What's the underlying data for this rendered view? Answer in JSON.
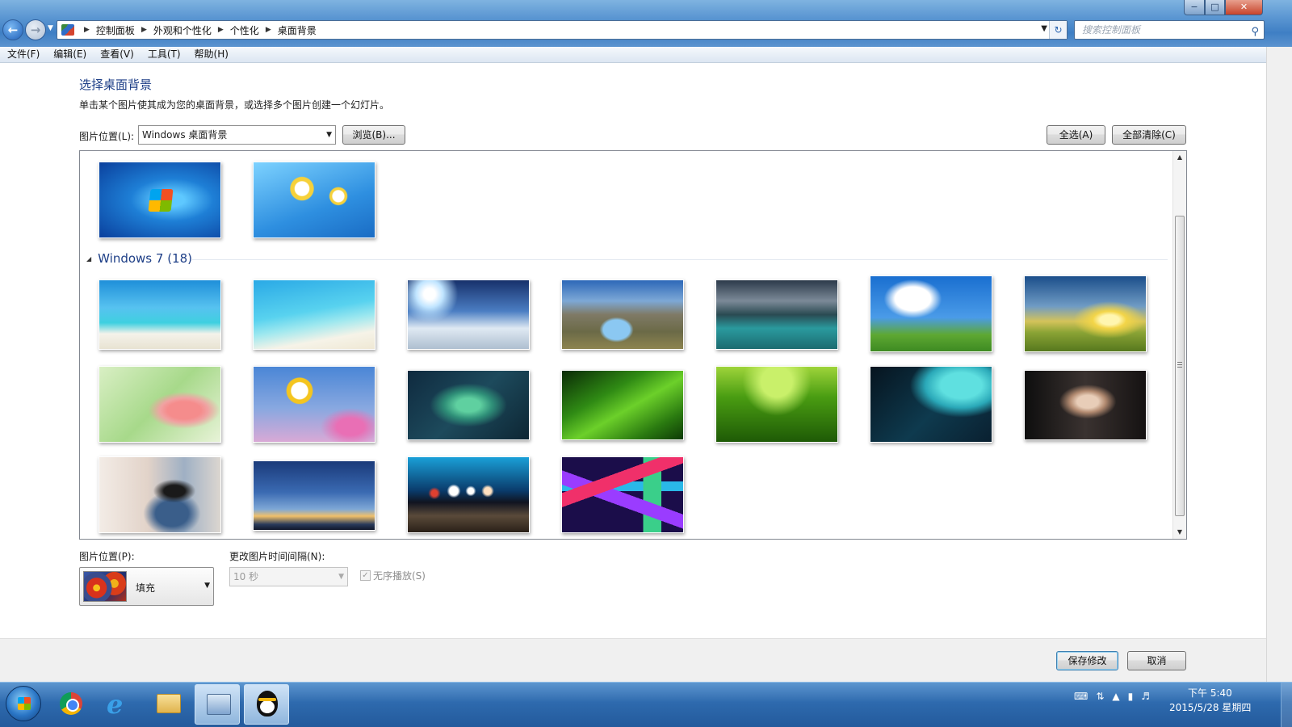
{
  "address": {
    "crumbs": [
      "控制面板",
      "外观和个性化",
      "个性化",
      "桌面背景"
    ],
    "search_placeholder": "搜索控制面板"
  },
  "window_controls": {
    "minimize": "−",
    "maximize": "□",
    "close": "✕"
  },
  "menu": [
    "文件(F)",
    "编辑(E)",
    "查看(V)",
    "工具(T)",
    "帮助(H)"
  ],
  "page": {
    "title": "选择桌面背景",
    "subtitle": "单击某个图片使其成为您的桌面背景，或选择多个图片创建一个幻灯片。",
    "location_label": "图片位置(L):",
    "location_value": "Windows 桌面背景",
    "browse_label": "浏览(B)...",
    "select_all_label": "全选(A)",
    "clear_all_label": "全部清除(C)"
  },
  "gallery": {
    "group_label": "Windows 7 (18)",
    "top_images": [
      "windows-7-logo",
      "daisy-on-blue"
    ],
    "images": [
      "tropical-beach",
      "turquoise-lagoon",
      "snow-sun",
      "mountain-lake",
      "glacier-lake",
      "cloud-meadow",
      "sunset-field",
      "pink-fuchsia",
      "daisies",
      "mint-leaves",
      "green-grass-drops",
      "lotus-leaves",
      "raindrops-umbrella",
      "girl-headphones",
      "girl-street",
      "dusk-sky",
      "bokeh-lights",
      "abstract-ribbons"
    ]
  },
  "position": {
    "label": "图片位置(P):",
    "value": "填充"
  },
  "interval": {
    "label": "更改图片时间间隔(N):",
    "value": "10 秒"
  },
  "shuffle": {
    "label": "无序播放(S)",
    "checked": true
  },
  "footer": {
    "save_label": "保存修改",
    "cancel_label": "取消"
  },
  "taskbar": {
    "apps": [
      "chrome-icon",
      "internet-explorer-icon",
      "explorer-folder-icon",
      "control-panel-icon",
      "qq-icon"
    ],
    "time": "下午 5:40",
    "date": "2015/5/28 星期四"
  }
}
